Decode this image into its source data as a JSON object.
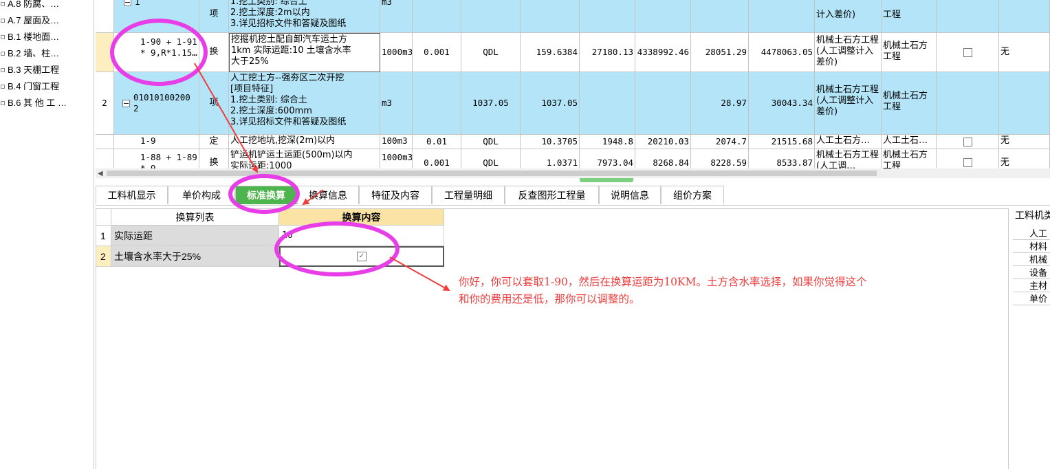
{
  "tree": {
    "items": [
      "A.8 防腐、…",
      "A.7 屋面及…",
      "B.1 楼地面…",
      "B.2 墙、柱…",
      "B.3 天棚工程",
      "B.4 门窗工程",
      "B.6 其 他 工 …"
    ]
  },
  "grid": {
    "rows": [
      {
        "rownum": "",
        "code": "1",
        "type": "项",
        "desc": [
          "1.挖土类别: 综合土",
          "2.挖土深度:2m以内",
          "3.详见招标文件和答疑及图纸"
        ],
        "unit": "m3",
        "qty": "",
        "expr": "",
        "price": "",
        "total_price": "",
        "c1": "",
        "c2": "",
        "c3": "",
        "c4": "",
        "prof": "计入差价)",
        "dept": "工程",
        "nocheck": false,
        "last": ""
      },
      {
        "rownum": "",
        "code": "1-90 + 1-91 * 9,R*1.15…",
        "type": "换",
        "desc": [
          "挖掘机挖土配自卸汽车运土方",
          "1km  实际运距:10  土壤含水率",
          "大于25%"
        ],
        "unit": "1000m3",
        "qty": "0.001",
        "expr": "QDL",
        "price": "159.6384",
        "total_price": "27180.13",
        "c1": "4338992.46",
        "c2": "28051.29",
        "c3": "4478063.05",
        "prof": "机械土石方工程(人工调整计入差价)",
        "dept": "机械土石方工程",
        "last": "无"
      },
      {
        "rownum": "2",
        "code": "010101002002",
        "type": "项",
        "desc": [
          "人工挖土方--强夯区二次开挖",
          "[项目特征]",
          "1.挖土类别: 综合土",
          "2.挖土深度:600mm",
          "3.详见招标文件和答疑及图纸"
        ],
        "unit": "m3",
        "qty": "",
        "expr": "1037.05",
        "price": "1037.05",
        "total_price": "",
        "c1": "",
        "c2": "28.97",
        "c3": "30043.34",
        "prof": "机械土石方工程(人工调整计入差价)",
        "dept": "机械土石方工程",
        "last": ""
      },
      {
        "rownum": "",
        "code": "1-9",
        "type": "定",
        "desc": [
          "人工挖地坑,挖深(2m)以内"
        ],
        "unit": "100m3",
        "qty": "0.01",
        "expr": "QDL",
        "price": "10.3705",
        "total_price": "1948.8",
        "c1": "20210.03",
        "c2": "2074.7",
        "c3": "21515.68",
        "prof": "人工土石方…",
        "dept": "人工土石…",
        "last": "无"
      },
      {
        "rownum": "",
        "code": "1-88 + 1-89 * 9",
        "type": "换",
        "desc": [
          "铲运机铲运土运距(500m)以内",
          "实际运距:1000"
        ],
        "unit": "1000m3",
        "qty": "0.001",
        "expr": "QDL",
        "price": "1.0371",
        "total_price": "7973.04",
        "c1": "8268.84",
        "c2": "8228.59",
        "c3": "8533.87",
        "prof": "机械土石方工程(人工调…",
        "dept": "机械土石方工程",
        "last": "无"
      }
    ]
  },
  "tabs": [
    "工料机显示",
    "单价构成",
    "标准换算",
    "换算信息",
    "特征及内容",
    "工程量明细",
    "反查图形工程量",
    "说明信息",
    "组价方案"
  ],
  "active_tab": "标准换算",
  "conversion": {
    "header_list": "换算列表",
    "header_content": "换算内容",
    "rows": [
      {
        "num": "1",
        "name": "实际运距",
        "value": "10"
      },
      {
        "num": "2",
        "name": "土壤含水率大于25%",
        "value": ""
      }
    ]
  },
  "right_panel": {
    "title": "工料机类",
    "items": [
      "人工",
      "材料",
      "机械",
      "设备",
      "主材",
      "单价"
    ]
  },
  "annotation": {
    "text_line1": "你好，你可以套取1-90，然后在换算运距为10KM。土方含水率选择，如果你觉得这个",
    "text_line2": "和你的费用还是低，那你可以调整的。",
    "color": "#ef3d3d",
    "circle_color": "#e83ee8"
  }
}
